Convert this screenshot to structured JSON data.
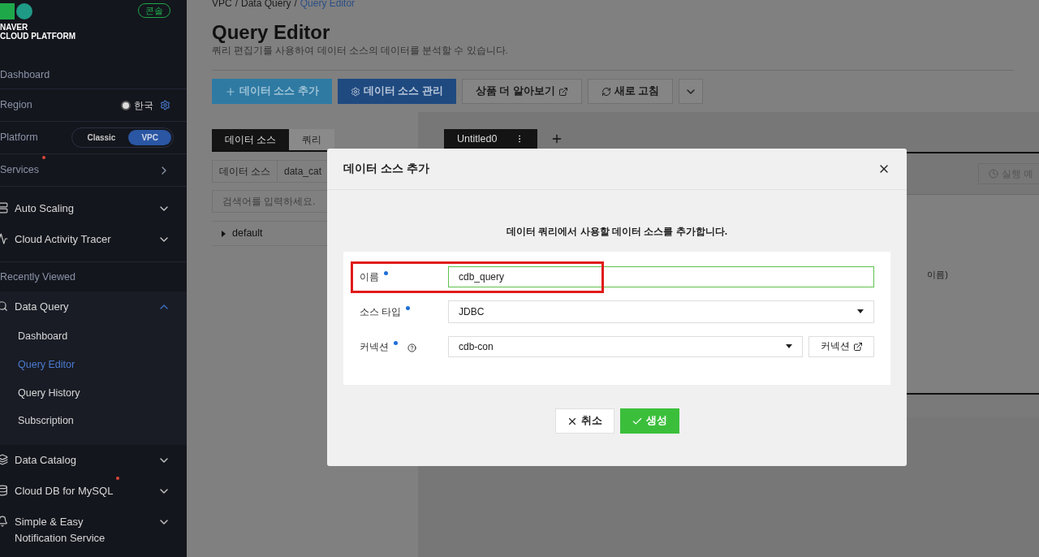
{
  "sidebar": {
    "logo": {
      "line1": "NAVER",
      "line2": "CLOUD PLATFORM"
    },
    "console_badge": "콘솔",
    "dashboard": "Dashboard",
    "region": {
      "label": "Region",
      "value": "한국"
    },
    "platform": {
      "label": "Platform",
      "options": [
        {
          "label": "Classic",
          "selected": false
        },
        {
          "label": "VPC",
          "selected": true
        }
      ]
    },
    "services": {
      "label": "Services",
      "new": true
    },
    "favorites": [
      {
        "label": "Auto Scaling",
        "expanded": false,
        "new": false
      },
      {
        "label": "Cloud Activity Tracer",
        "expanded": false,
        "new": false
      }
    ],
    "recent_title": "Recently Viewed",
    "recent": [
      {
        "label": "Data Query",
        "expanded": true,
        "new": false,
        "children": [
          {
            "label": "Dashboard",
            "selected": false
          },
          {
            "label": "Query Editor",
            "selected": true
          },
          {
            "label": "Query History",
            "selected": false
          },
          {
            "label": "Subscription",
            "selected": false
          }
        ]
      },
      {
        "label": "Data Catalog",
        "expanded": false,
        "new": false
      },
      {
        "label": "Cloud DB for MySQL",
        "expanded": false,
        "new": true
      },
      {
        "label": "Simple & Easy Notification Service",
        "expanded": false,
        "new": false
      }
    ]
  },
  "breadcrumb": [
    {
      "label": "VPC",
      "selected": false,
      "separator": "/"
    },
    {
      "label": "Data Query",
      "selected": false,
      "separator": "/"
    },
    {
      "label": "Query Editor",
      "selected": true
    }
  ],
  "page": {
    "title": "Query Editor",
    "subtitle": "쿼리 편집기를 사용하여 데이터 소스의 데이터를 분석할 수 있습니다."
  },
  "toolbar": [
    {
      "kind": "add",
      "label": "데이터 소스 추가"
    },
    {
      "kind": "manage",
      "label": "데이터 소스 관리"
    },
    {
      "kind": "link",
      "label": "상품 더 알아보기"
    },
    {
      "kind": "refresh",
      "label": "새로 고침"
    },
    {
      "kind": "more"
    }
  ],
  "left_tabs": [
    {
      "label": "데이터 소스",
      "selected": true
    },
    {
      "label": "쿼리",
      "selected": false
    }
  ],
  "source_row": [
    "데이터 소스",
    "data_cat"
  ],
  "search": {
    "placeholder": "검색어를 입력하세요."
  },
  "tree": [
    {
      "label": "default",
      "expanded": false
    }
  ],
  "editor_tabs": [
    {
      "label": "Untitled0",
      "selected": true
    }
  ],
  "schedule_button": "실행 예",
  "editor_hint": "이름)",
  "modal": {
    "title": "데이터 소스 추가",
    "description": "데이터 쿼리에서 사용할 데이터 소스를 추가합니다.",
    "fields": [
      {
        "kind": "text",
        "label": "이름",
        "required": true,
        "help": false,
        "value": "cdb_query",
        "highlighted": true
      },
      {
        "kind": "select",
        "label": "소스 타입",
        "required": true,
        "help": false,
        "value": "JDBC",
        "highlighted": false
      },
      {
        "kind": "select_link",
        "label": "커넥션",
        "required": true,
        "help": true,
        "value": "cdb-con",
        "link": "커넥션",
        "highlighted": false
      }
    ],
    "buttons": [
      {
        "kind": "cancel",
        "label": "취소"
      },
      {
        "kind": "confirm",
        "label": "생성"
      }
    ]
  }
}
